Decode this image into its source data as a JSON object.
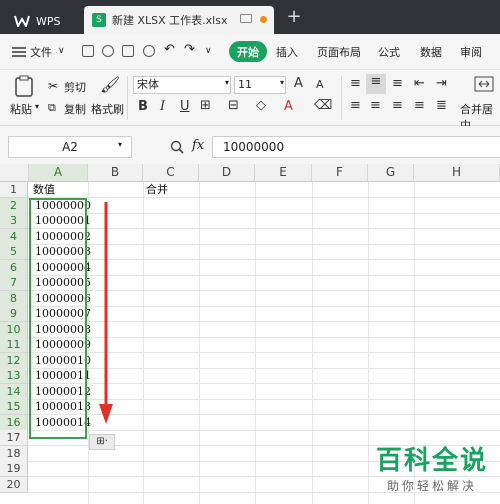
{
  "titlebar": {
    "app_tab": "WPS",
    "doc_tab": "新建 XLSX 工作表.xlsx",
    "new_tab": "+"
  },
  "menubar": {
    "file": "文件",
    "start": "开始",
    "items": [
      "插入",
      "页面布局",
      "公式",
      "数据",
      "审阅"
    ]
  },
  "ribbon": {
    "paste": "粘贴",
    "cut": "剪切",
    "copy": "复制",
    "format_painter": "格式刷",
    "font_name": "宋体",
    "font_size": "11",
    "bold": "B",
    "italic": "I",
    "underline": "U",
    "font_color": "A",
    "grow_font": "A",
    "shrink_font": "A",
    "merge_center": "合并居中"
  },
  "formula": {
    "cell_ref": "A2",
    "fx": "fx",
    "value": "10000000"
  },
  "columns": [
    "A",
    "B",
    "C",
    "D",
    "E",
    "F",
    "G",
    "H"
  ],
  "rows": [
    "1",
    "2",
    "3",
    "4",
    "5",
    "6",
    "7",
    "8",
    "9",
    "10",
    "11",
    "12",
    "13",
    "14",
    "15",
    "16",
    "17",
    "18",
    "19",
    "20"
  ],
  "cells": {
    "A1": "数值",
    "C1": "合并",
    "A_values": [
      "10000000",
      "10000001",
      "10000002",
      "10000003",
      "10000004",
      "10000005",
      "10000006",
      "10000007",
      "10000008",
      "10000009",
      "10000010",
      "10000011",
      "10000012",
      "10000013",
      "10000014"
    ]
  },
  "autofill": "⊞·",
  "watermark": {
    "main": "百科全说",
    "sub": "助你轻松解决"
  },
  "colors": {
    "accent": "#1aa260",
    "selection": "#3d9f4a",
    "arrow": "#e0302a"
  }
}
